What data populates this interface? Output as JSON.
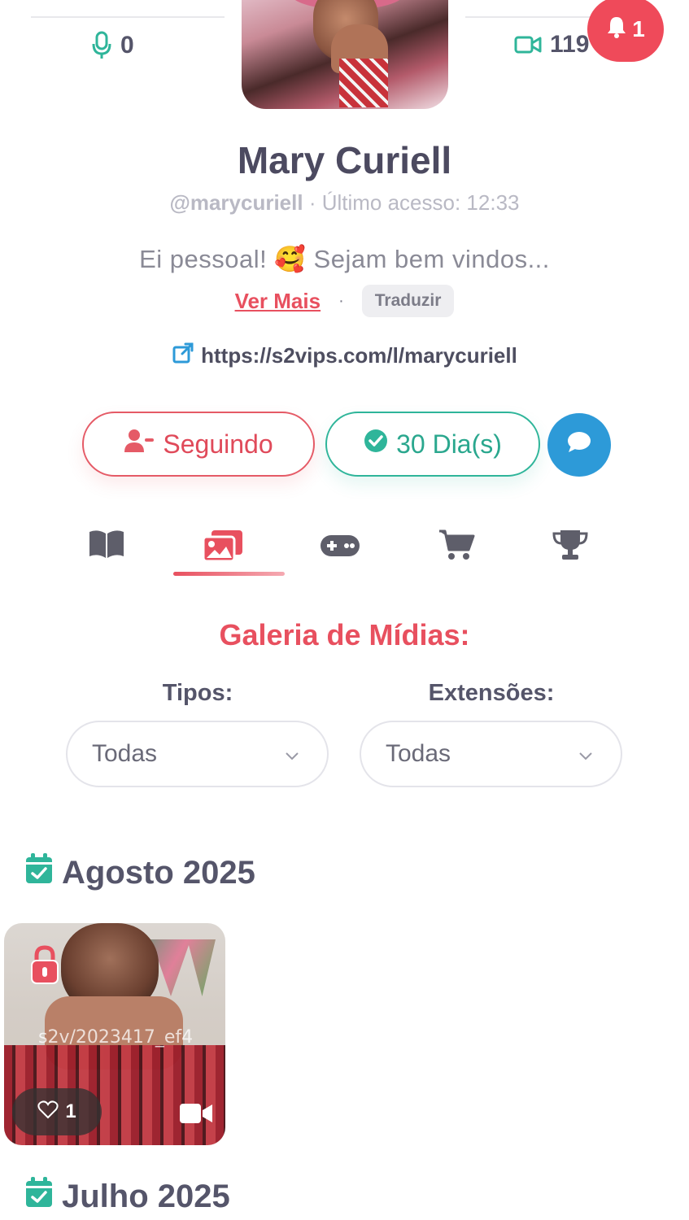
{
  "stats": {
    "mic_icon": "microphone-icon",
    "mic_count": "0",
    "video_icon": "video-camera-icon",
    "video_count": "119"
  },
  "notifications": {
    "icon": "bell-icon",
    "count": "1",
    "color": "#ef4a5a"
  },
  "profile": {
    "name": "Mary Curiell",
    "handle": "@marycuriell",
    "separator": " · ",
    "last_access": "Último acesso: 12:33",
    "bio": "Ei pessoal! 🥰 Sejam bem vindos...",
    "see_more": "Ver Mais",
    "dot": "·",
    "translate": "Traduzir",
    "link_icon": "external-link-icon",
    "link": "https://s2vips.com/l/marycuriell"
  },
  "actions": {
    "follow_label": "Seguindo",
    "follow_icon": "user-minus-icon",
    "subscription_label": "30 Dia(s)",
    "subscription_icon": "check-circle-icon",
    "chat_icon": "chat-bubble-icon",
    "accent_red": "#e8505f",
    "accent_green": "#2fb59a",
    "accent_blue": "#2d9ad8"
  },
  "tabs": [
    {
      "icon": "book-icon",
      "active": false
    },
    {
      "icon": "images-icon",
      "active": true
    },
    {
      "icon": "gamepad-icon",
      "active": false
    },
    {
      "icon": "shopping-cart-icon",
      "active": false
    },
    {
      "icon": "trophy-icon",
      "active": false
    }
  ],
  "gallery": {
    "title": "Galeria de Mídias:",
    "types_label": "Tipos:",
    "types_value": "Todas",
    "extensions_label": "Extensões:",
    "extensions_value": "Todas"
  },
  "months": [
    {
      "label": "Agosto 2025",
      "icon": "calendar-check-icon",
      "items": [
        {
          "watermark": "s2v/2023417_ef4",
          "likes": "1",
          "locked": true,
          "media_type": "video"
        }
      ]
    },
    {
      "label": "Julho 2025",
      "icon": "calendar-check-icon",
      "items": []
    }
  ]
}
